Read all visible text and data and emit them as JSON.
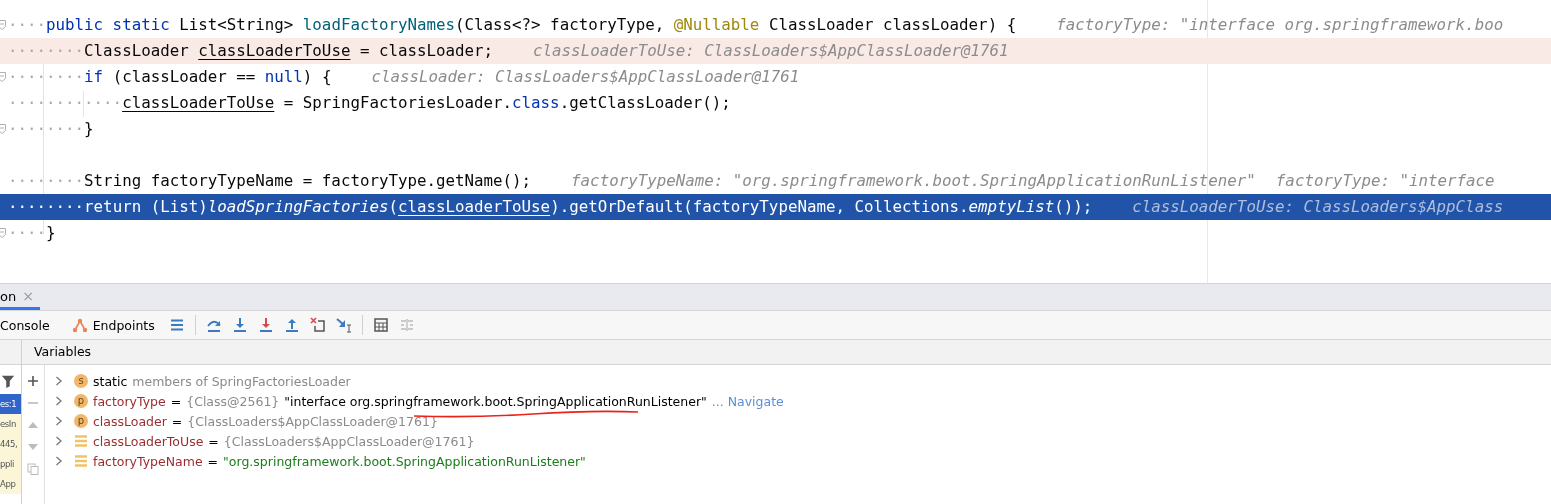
{
  "editor": {
    "lines": [
      {
        "indent": "····",
        "fold": true,
        "executed": false,
        "current": false,
        "tokens": [
          {
            "kind": "kw",
            "text": "public static "
          },
          {
            "kind": "plain",
            "text": "List<String> "
          },
          {
            "kind": "method",
            "text": "loadFactoryNames"
          },
          {
            "kind": "plain",
            "text": "(Class<?> factoryType, "
          },
          {
            "kind": "annotation",
            "text": "@Nullable"
          },
          {
            "kind": "plain",
            "text": " ClassLoader classLoader) {"
          }
        ],
        "hints": [
          "factoryType: \"interface org.springframework.boo"
        ]
      },
      {
        "indent": "········",
        "fold": false,
        "executed": true,
        "current": false,
        "tokens": [
          {
            "kind": "plain",
            "text": "ClassLoader "
          },
          {
            "kind": "underline",
            "text": "classLoaderToUse"
          },
          {
            "kind": "plain",
            "text": " = classLoader;"
          }
        ],
        "hints": [
          "classLoaderToUse: ClassLoaders$AppClassLoader@1761"
        ]
      },
      {
        "indent": "········",
        "fold": true,
        "executed": false,
        "current": false,
        "tokens": [
          {
            "kind": "kw",
            "text": "if"
          },
          {
            "kind": "plain",
            "text": " (classLoader == "
          },
          {
            "kind": "kw",
            "text": "null"
          },
          {
            "kind": "plain",
            "text": ") {"
          }
        ],
        "hints": [
          "classLoader: ClassLoaders$AppClassLoader@1761"
        ]
      },
      {
        "indent": "············",
        "fold": false,
        "executed": false,
        "current": false,
        "tokens": [
          {
            "kind": "underline",
            "text": "classLoaderToUse"
          },
          {
            "kind": "plain",
            "text": " = SpringFactoriesLoader."
          },
          {
            "kind": "kw",
            "text": "class"
          },
          {
            "kind": "plain",
            "text": ".getClassLoader();"
          }
        ]
      },
      {
        "indent": "········",
        "fold": true,
        "executed": false,
        "current": false,
        "tokens": [
          {
            "kind": "plain",
            "text": "}"
          }
        ]
      },
      {
        "fold": false,
        "executed": false,
        "current": false
      },
      {
        "indent": "········",
        "fold": false,
        "executed": false,
        "current": false,
        "tokens": [
          {
            "kind": "plain",
            "text": "String factoryTypeName = factoryType.getName();"
          }
        ],
        "hints": [
          "factoryTypeName: \"org.springframework.boot.SpringApplicationRunListener\"",
          "factoryType: \"interface"
        ]
      },
      {
        "indent": "········",
        "fold": false,
        "executed": false,
        "current": true,
        "tokens": [
          {
            "kind": "plain",
            "text": "return (List)"
          },
          {
            "kind": "italic",
            "text": "loadSpringFactories"
          },
          {
            "kind": "plain",
            "text": "("
          },
          {
            "kind": "underline",
            "text": "classLoaderToUse"
          },
          {
            "kind": "plain",
            "text": ").getOrDefault(factoryTypeName, Collections."
          },
          {
            "kind": "italic",
            "text": "emptyList"
          },
          {
            "kind": "plain",
            "text": "());"
          }
        ],
        "hints": [
          "classLoaderToUse: ClassLoaders$AppClass"
        ]
      },
      {
        "indent": "····",
        "fold": true,
        "executed": false,
        "current": false,
        "tokens": [
          {
            "kind": "plain",
            "text": "}"
          }
        ]
      }
    ]
  },
  "tool_window": {
    "tab": {
      "label": "on",
      "close": "×",
      "selected": true
    },
    "toolbar": {
      "console": "Console",
      "endpoints": "Endpoints"
    },
    "frames": [
      {
        "label": "es:1",
        "selected": true
      },
      {
        "label": "esIn",
        "selected": false
      },
      {
        "label": "445,",
        "selected": false
      },
      {
        "label": "ppli",
        "selected": false
      },
      {
        "label": "App",
        "selected": false
      }
    ],
    "variables": {
      "title": "Variables",
      "rows": [
        {
          "kind": "static",
          "badge": "s",
          "keyword": "static",
          "text": "members of SpringFactoriesLoader"
        },
        {
          "kind": "param",
          "badge": "p",
          "name": "factoryType",
          "operator": "=",
          "ref": "{Class@2561}",
          "value": "\"interface org.springframework.boot.SpringApplicationRunListener\"",
          "string_value": false,
          "link": "... Navigate"
        },
        {
          "kind": "param",
          "badge": "p",
          "name": "classLoader",
          "operator": "=",
          "ref": "{ClassLoaders$AppClassLoader@1761}"
        },
        {
          "kind": "local",
          "name": "classLoaderToUse",
          "operator": "=",
          "ref": "{ClassLoaders$AppClassLoader@1761}"
        },
        {
          "kind": "local",
          "name": "factoryTypeName",
          "operator": "=",
          "value": "\"org.springframework.boot.SpringApplicationRunListener\"",
          "string_value": true
        }
      ]
    }
  }
}
